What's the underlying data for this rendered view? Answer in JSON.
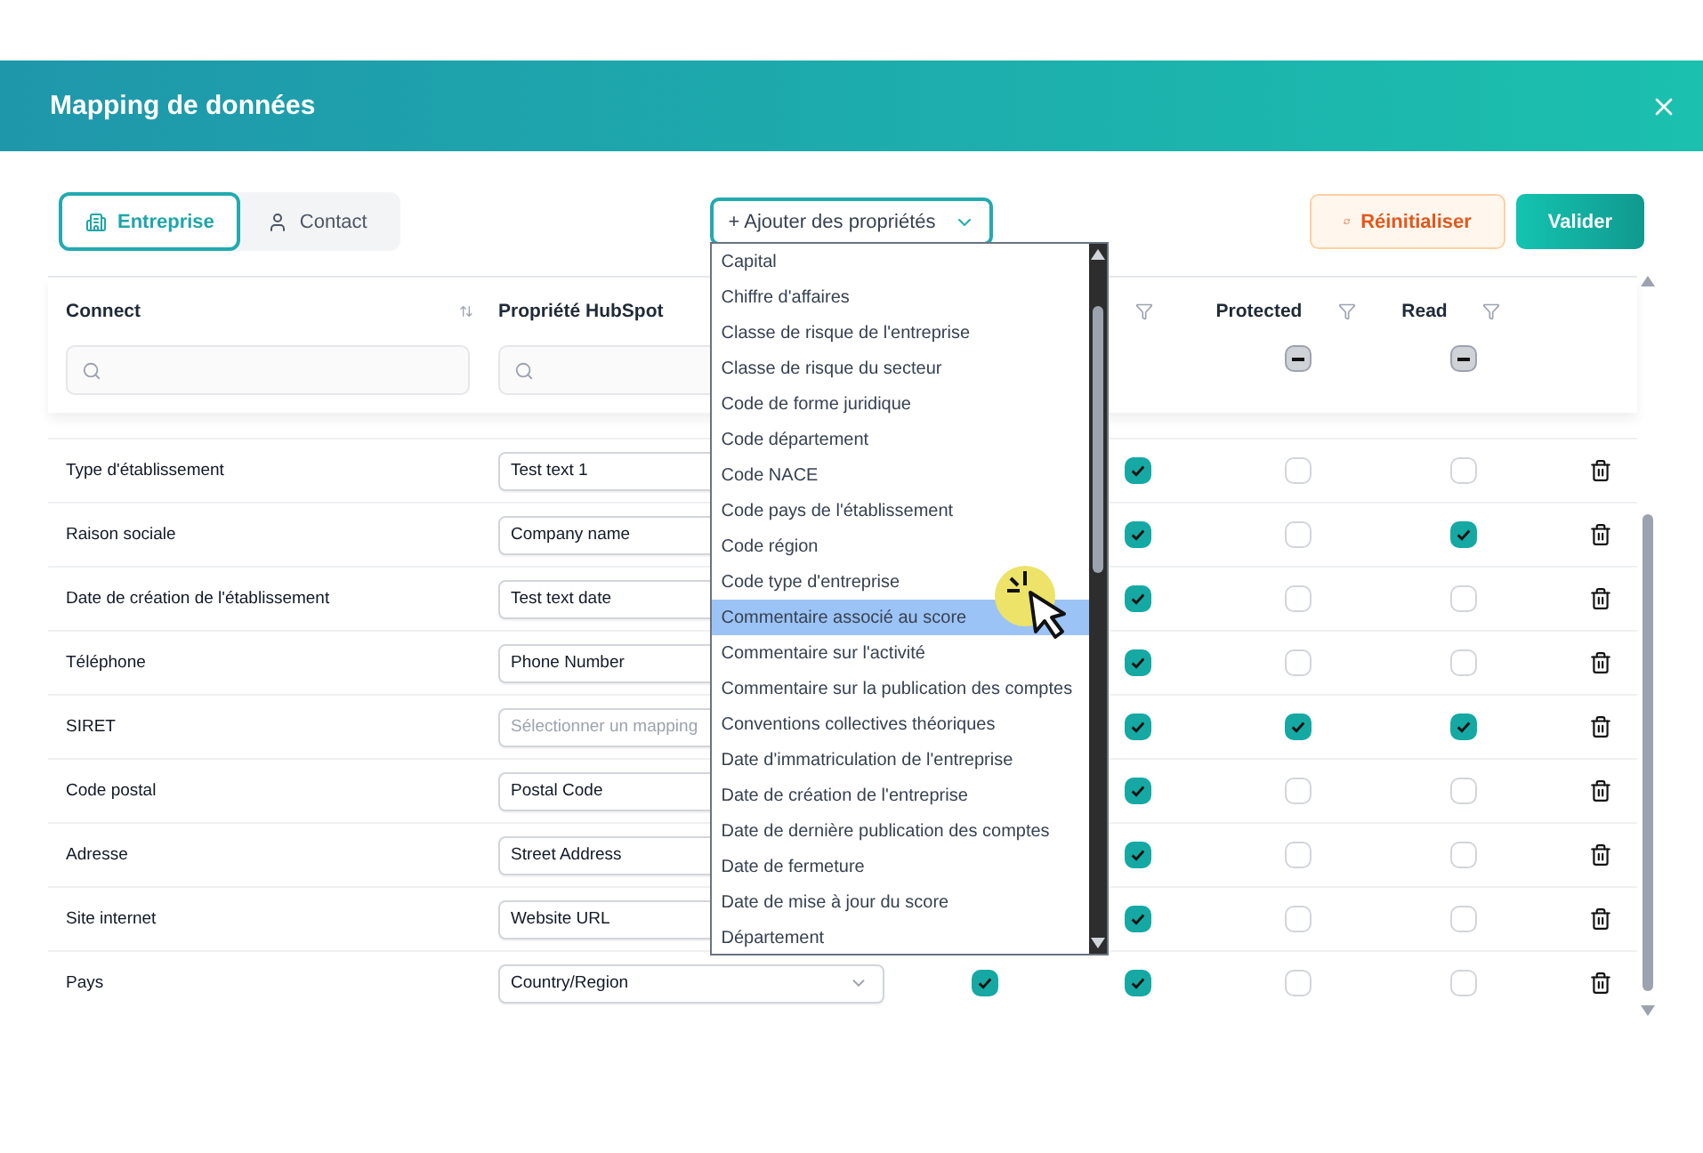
{
  "dialog": {
    "title": "Mapping de données"
  },
  "tabs": [
    {
      "label": "Entreprise",
      "selected": true
    },
    {
      "label": "Contact",
      "selected": false
    }
  ],
  "add_properties": {
    "label": "+ Ajouter des propriétés",
    "expanded": true,
    "options": [
      {
        "label": "Capital",
        "selected": false
      },
      {
        "label": "Chiffre d'affaires",
        "selected": false
      },
      {
        "label": "Classe de risque de l'entreprise",
        "selected": false
      },
      {
        "label": "Classe de risque du secteur",
        "selected": false
      },
      {
        "label": "Code de forme juridique",
        "selected": false
      },
      {
        "label": "Code département",
        "selected": false
      },
      {
        "label": "Code NACE",
        "selected": false
      },
      {
        "label": "Code pays de l'établissement",
        "selected": false
      },
      {
        "label": "Code région",
        "selected": false
      },
      {
        "label": "Code type d'entreprise",
        "selected": false
      },
      {
        "label": "Commentaire associé au score",
        "selected": true
      },
      {
        "label": "Commentaire sur l'activité",
        "selected": false
      },
      {
        "label": "Commentaire sur la publication des comptes",
        "selected": false
      },
      {
        "label": "Conventions collectives théoriques",
        "selected": false
      },
      {
        "label": "Date d'immatriculation de l'entreprise",
        "selected": false
      },
      {
        "label": "Date de création de l'entreprise",
        "selected": false
      },
      {
        "label": "Date de dernière publication des comptes",
        "selected": false
      },
      {
        "label": "Date de fermeture",
        "selected": false
      },
      {
        "label": "Date de mise à jour du score",
        "selected": false
      },
      {
        "label": "Département",
        "selected": false
      }
    ]
  },
  "buttons": [
    {
      "label": "Réinitialiser",
      "kind": "secondary"
    },
    {
      "label": "Valider",
      "kind": "primary"
    }
  ],
  "table": {
    "columns": [
      {
        "label": "Connect",
        "kind": "sort"
      },
      {
        "label": "Propriété HubSpot",
        "kind": "plain"
      },
      {
        "label": "Protected",
        "kind": "filter",
        "header_indeterminate": true
      },
      {
        "label": "Read",
        "kind": "filter",
        "header_indeterminate": true
      }
    ],
    "rows": [
      {
        "connect": "Type d'établissement",
        "hubspot": "Test text 1",
        "column_4_checked": true,
        "protected": false,
        "read": false
      },
      {
        "connect": "Raison sociale",
        "hubspot": "Company name",
        "column_4_checked": true,
        "protected": false,
        "read": true
      },
      {
        "connect": "Date de création de l'établissement",
        "hubspot": "Test text date",
        "column_4_checked": true,
        "protected": false,
        "read": false
      },
      {
        "connect": "Téléphone",
        "hubspot": "Phone Number",
        "column_4_checked": true,
        "protected": false,
        "read": false
      },
      {
        "connect": "SIRET",
        "placeholder": "Sélectionner un mapping",
        "column_4_checked": true,
        "protected": true,
        "read": true
      },
      {
        "connect": "Code postal",
        "hubspot": "Postal Code",
        "column_4_checked": true,
        "protected": false,
        "read": false
      },
      {
        "connect": "Adresse",
        "hubspot": "Street Address",
        "column_4_checked": true,
        "protected": false,
        "read": false
      },
      {
        "connect": "Site internet",
        "hubspot": "Website URL",
        "column_4_checked": true,
        "protected": false,
        "read": false
      },
      {
        "connect": "Pays",
        "hubspot": "Country/Region",
        "column_3_checked": true,
        "column_4_checked": true,
        "protected": false,
        "read": false
      }
    ]
  }
}
